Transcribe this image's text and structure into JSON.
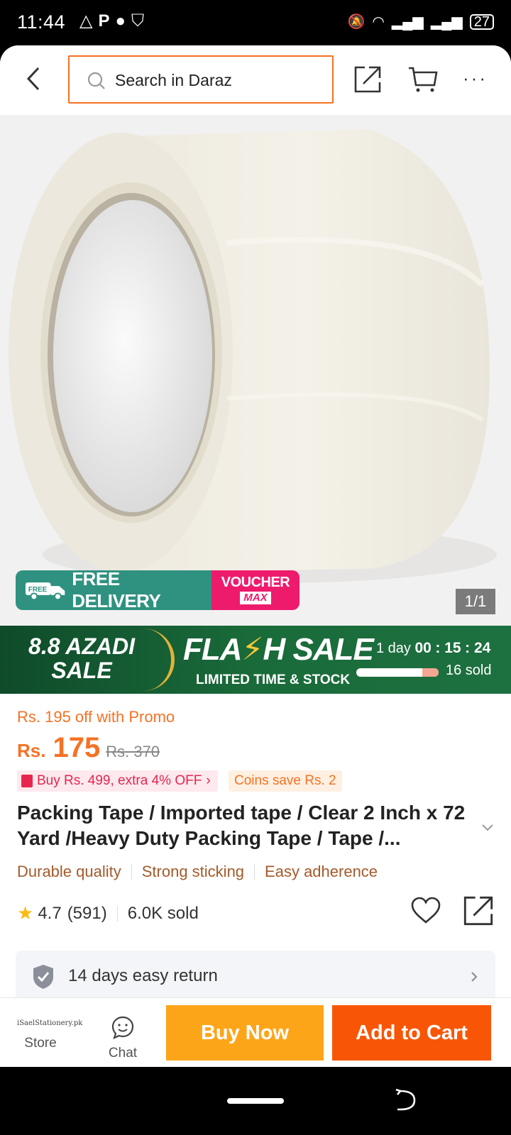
{
  "status_bar": {
    "time": "11:44",
    "left_icons": [
      "warning-triangle-icon",
      "p-icon",
      "facebook-icon",
      "shield-icon"
    ],
    "right_icons": [
      "mute-icon",
      "wifi-icon",
      "signal-icon",
      "signal-icon"
    ],
    "battery": "27"
  },
  "header": {
    "search_placeholder": "Search in Daraz",
    "accent_color": "#f57224"
  },
  "image": {
    "counter": "1/1",
    "badge_free_delivery": "FREE DELIVERY",
    "badge_free_small": "FREE",
    "badge_voucher_line1": "VOUCHER",
    "badge_voucher_line2": "MAX"
  },
  "flash_banner": {
    "azadi_line1": "8.8 AZADI",
    "azadi_line2": "SALE",
    "title_part1": "FLA",
    "title_bolt": "⚡",
    "title_part2": "H SALE",
    "subtitle": "LIMITED TIME & STOCK",
    "timer_prefix": "1 day",
    "timer_h": "00",
    "timer_m": "15",
    "timer_s": "24",
    "sold_fraction": 0.2,
    "sold_text": "16 sold"
  },
  "product": {
    "promo_line": "Rs. 195 off with Promo",
    "currency": "Rs.",
    "price": "175",
    "old_price": "Rs. 370",
    "tag_buy": "Buy Rs. 499, extra 4% OFF",
    "tag_coins": "Coins save Rs. 2",
    "title": "Packing Tape / Imported tape / Clear 2 Inch x 72 Yard /Heavy Duty Packing Tape / Tape /...",
    "features": [
      "Durable quality",
      "Strong sticking",
      "Easy adherence"
    ],
    "rating": "4.7",
    "rating_count": "(591)",
    "sold": "6.0K sold",
    "return_policy": "14 days easy return"
  },
  "bottom_bar": {
    "store_logo_text": "iSaelStationery.pk",
    "store_label": "Store",
    "chat_label": "Chat",
    "buy_now": "Buy Now",
    "add_to_cart": "Add to Cart"
  }
}
